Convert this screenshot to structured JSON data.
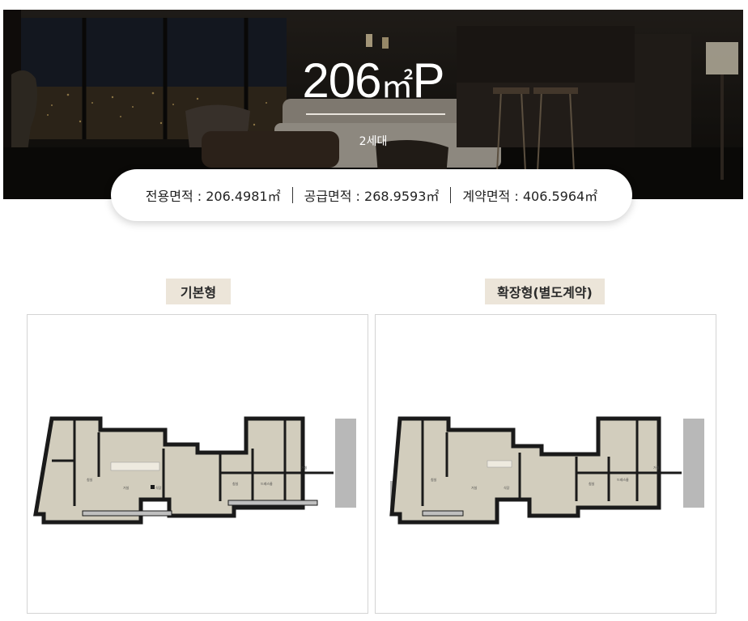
{
  "hero": {
    "size_number": "206",
    "size_unit": "㎡",
    "size_type": "P",
    "households": "2세대",
    "bg_colors": {
      "top": "#2a2520",
      "bottom": "#0f0d0b"
    }
  },
  "area": {
    "exclusive": "전용면적 : 206.4981㎡",
    "supply": "공급면적 : 268.9593㎡",
    "contract": "계약면적 : 406.5964㎡"
  },
  "plans": [
    {
      "label": "기본형"
    },
    {
      "label": "확장형(별도계약)"
    }
  ],
  "colors": {
    "label_bg": "#ece5d9",
    "panel_border": "#d4d4d4",
    "wall": "#1a1a1a",
    "floor": "#d2cdbd",
    "terrace": "#b8b8b8"
  }
}
